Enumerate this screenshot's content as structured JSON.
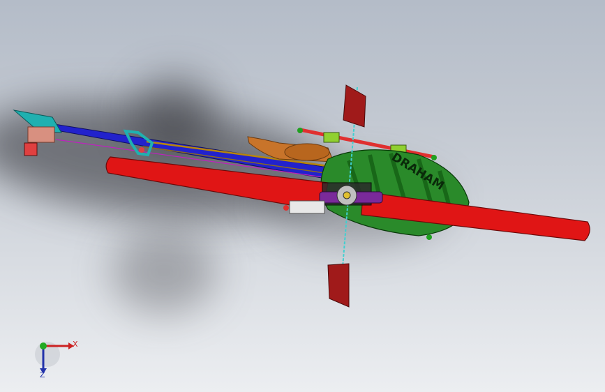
{
  "viewport": {
    "background_top": "#b4bcc8",
    "background_bottom": "#eceef1"
  },
  "model": {
    "decal_text": "DRAHAM",
    "colors": {
      "main_blade": "#e01515",
      "canopy": "#2a8a2a",
      "tail_boom": "#2222cc",
      "tail_fin": "#20b0b0",
      "muffler": "#c8742a",
      "flybar_paddle": "#a01a1a",
      "rotor_head": "#7a2a9a",
      "shaft": "#40d0d0"
    }
  },
  "triad": {
    "x_label": "X",
    "z_label": "Z",
    "x_color": "#cc2222",
    "z_color": "#2233aa",
    "y_color": "#22aa22"
  }
}
